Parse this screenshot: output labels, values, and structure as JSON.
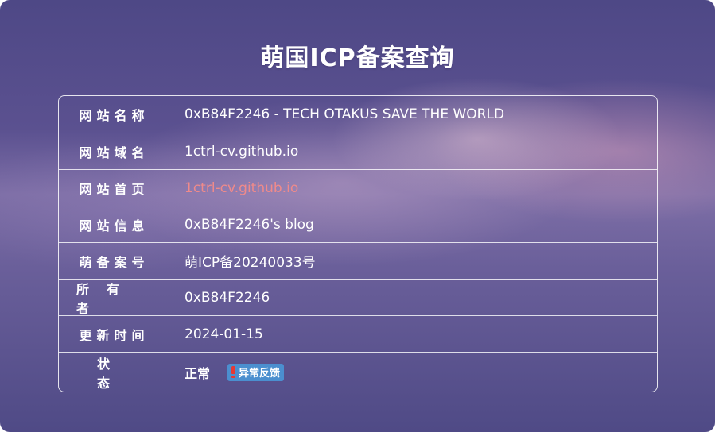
{
  "page": {
    "title": "萌国ICP备案查询"
  },
  "labels": {
    "site_name": "网站名称",
    "domain": "网站域名",
    "homepage": "网站首页",
    "info": "网站信息",
    "record_no": "萌备案号",
    "owner": "所有者",
    "updated": "更新时间",
    "status": "状态"
  },
  "values": {
    "site_name": "0xB84F2246 - TECH OTAKUS SAVE THE WORLD",
    "domain": "1ctrl-cv.github.io",
    "homepage": "1ctrl-cv.github.io",
    "info": "0xB84F2246's blog",
    "record_no": "萌ICP备20240033号",
    "owner": "0xB84F2246",
    "updated": "2024-01-15",
    "status": "正常",
    "feedback_button": "异常反馈"
  },
  "colors": {
    "link": "#f08a8a",
    "feedback_button_bg": "#4b8fcf",
    "icon_red": "#e53935"
  },
  "icons": {
    "feedback": "exclamation-icon"
  }
}
